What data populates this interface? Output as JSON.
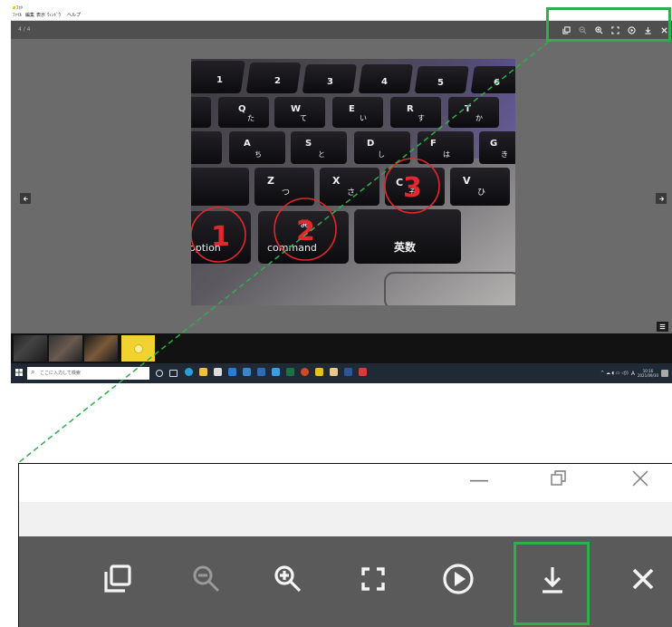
{
  "app": {
    "name": "ﾌｫﾄ",
    "menu": [
      "ﾌｧｲﾙ",
      "編集",
      "表示",
      "ｳｨﾝﾄﾞｳ",
      "ヘルプ"
    ],
    "page_counter": "4 / 4"
  },
  "toolbar_icons": [
    "copy-icon",
    "zoom-out-icon",
    "zoom-in-icon",
    "fullscreen-icon",
    "slideshow-play-icon",
    "download-icon",
    "close-icon"
  ],
  "photo": {
    "keys_row1": [
      "1",
      "2",
      "3",
      "4",
      "5",
      "6"
    ],
    "keys_row2": [
      "Q",
      "W",
      "E",
      "R",
      "T"
    ],
    "keys_row3": [
      "A",
      "S",
      "D",
      "F",
      "G"
    ],
    "keys_row4": [
      "Z",
      "X",
      "C",
      "V"
    ],
    "kana_row2": [
      "た",
      "て",
      "い",
      "す",
      "か"
    ],
    "kana_row3": [
      "ち",
      "と",
      "し",
      "は",
      "き"
    ],
    "kana_row4": [
      "つ",
      "さ",
      "そ",
      "ひ"
    ],
    "option_label": "option",
    "command_label": "command",
    "eisu_label": "英数",
    "command_symbol": "⌘",
    "annotations": [
      "1",
      "2",
      "3"
    ]
  },
  "taskbar": {
    "search_placeholder": "ここに入力して検索",
    "clock_time": "10:16",
    "clock_date": "2021/09/30",
    "ime": "A"
  },
  "colors": {
    "highlight": "#2fae4a",
    "annotation_red": "#e0282d"
  }
}
